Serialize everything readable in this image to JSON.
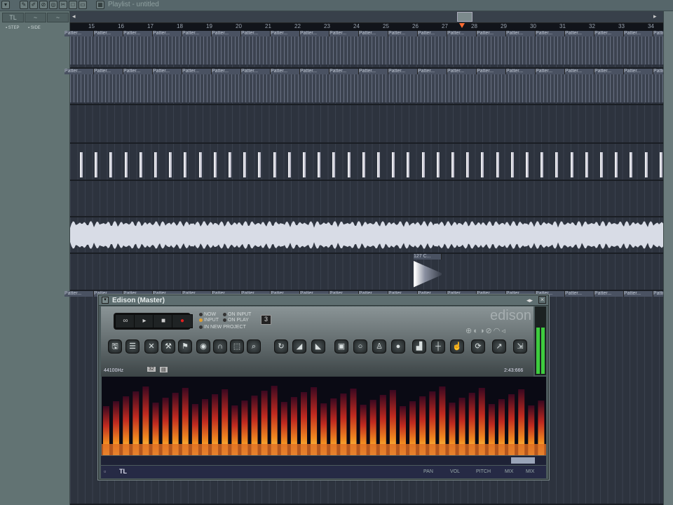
{
  "window": {
    "title": "Playlist - untitled"
  },
  "toolbar": {
    "icons": [
      "menu-icon",
      "pencil-icon",
      "paint-icon",
      "delete-icon",
      "mute-icon",
      "slice-icon",
      "select-icon",
      "zoom-icon",
      "snap-icon"
    ]
  },
  "left_panel": {
    "tabs": [
      "TL",
      "~",
      "~"
    ],
    "options": [
      "STEP",
      "SIDE"
    ]
  },
  "ruler": {
    "bars": [
      "15",
      "16",
      "17",
      "18",
      "19",
      "20",
      "21",
      "22",
      "23",
      "24",
      "25",
      "26",
      "27",
      "28",
      "29",
      "30",
      "31",
      "32",
      "33",
      "34"
    ]
  },
  "clip_label": "Patter...",
  "sample_clip_label": "127 C...",
  "edison": {
    "title": "Edison (Master)",
    "logo": "edison",
    "transport": [
      "∞",
      "▸",
      "■",
      "●"
    ],
    "record_options": [
      {
        "label": "NOW",
        "on": false
      },
      {
        "label": "ON INPUT",
        "on": false
      },
      {
        "label": "INPUT",
        "on": true
      },
      {
        "label": "ON PLAY",
        "on": false
      },
      {
        "label": "IN NEW PROJECT",
        "on": false
      }
    ],
    "counter": "3",
    "sample_rate": "44100Hz",
    "bits": "32",
    "length": "2:43:666",
    "footer_knobs": [
      "PAN",
      "VOL",
      "PITCH",
      "MIX",
      "MIX"
    ],
    "footer_left": "TL"
  },
  "colors": {
    "accent": "#e0a030",
    "meter": "#3ecc3e"
  }
}
